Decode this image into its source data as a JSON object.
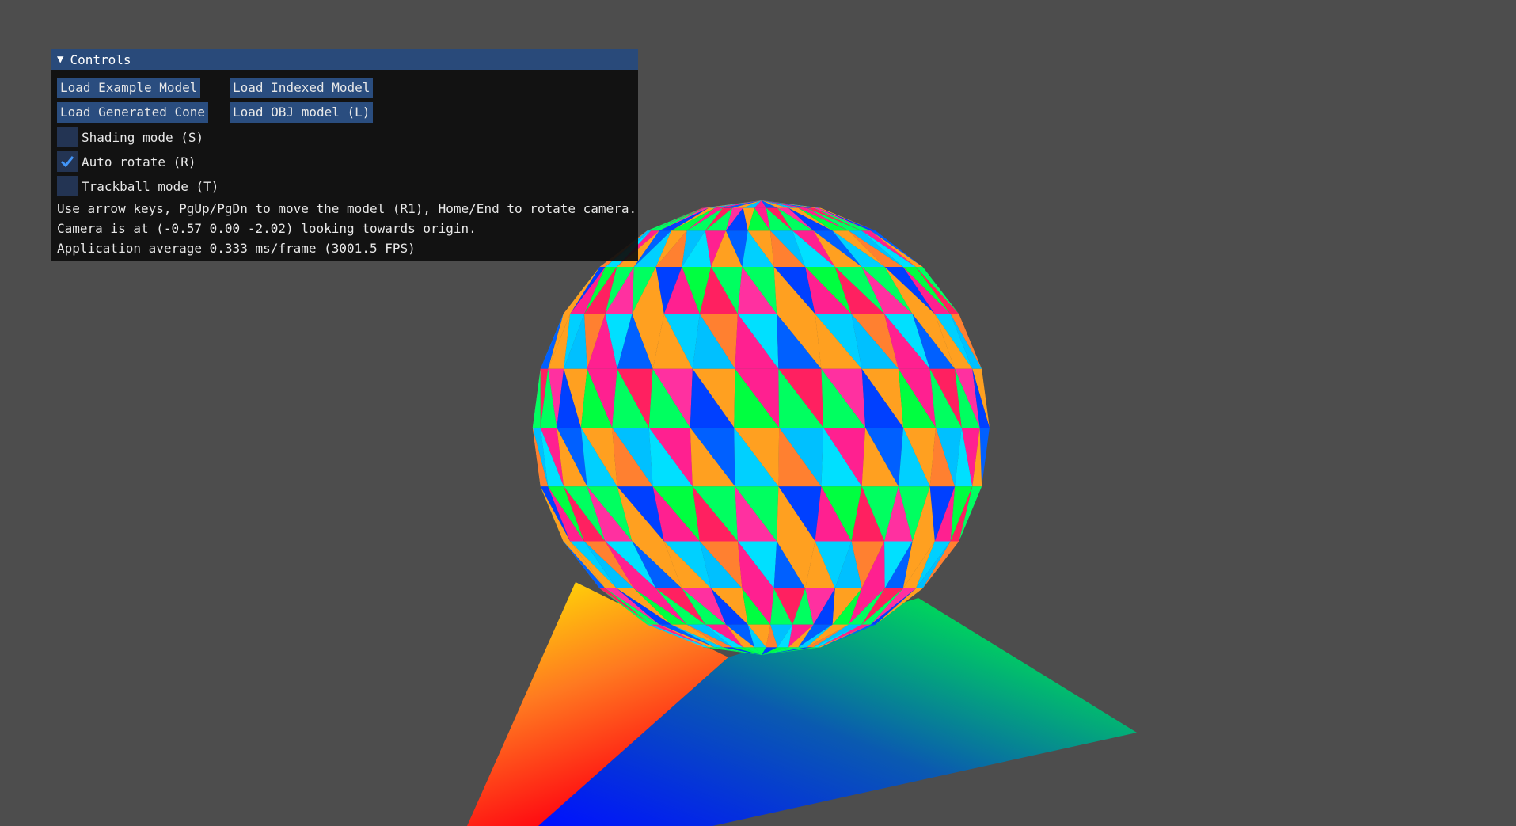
{
  "window": {
    "background": "#4d4d4d"
  },
  "controls": {
    "title": "Controls",
    "buttons": {
      "load_example": "Load Example Model",
      "load_indexed": "Load Indexed Model",
      "load_cone": "Load Generated Cone",
      "load_obj": "Load OBJ model (L)"
    },
    "checkboxes": {
      "shading": {
        "label": "Shading mode (S)",
        "checked": false
      },
      "auto_rotate": {
        "label": "Auto rotate (R)",
        "checked": true
      },
      "trackball": {
        "label": "Trackball mode (T)",
        "checked": false
      }
    },
    "info": {
      "keys_help": "Use arrow keys, PgUp/PgDn to move the model (R1), Home/End to rotate camera.",
      "camera": "Camera is at (-0.57 0.00 -2.02) looking towards origin.",
      "fps": "Application average 0.333 ms/frame (3001.5 FPS)"
    },
    "colors": {
      "title_bar": "#294a7a",
      "button": "#2a4d7f",
      "checkbox": "#233453",
      "checkmark": "#4296fa",
      "panel": "#0f0f0f"
    }
  },
  "scene": {
    "objects": [
      "rainbow-sphere",
      "gradient-ground-plane"
    ]
  }
}
